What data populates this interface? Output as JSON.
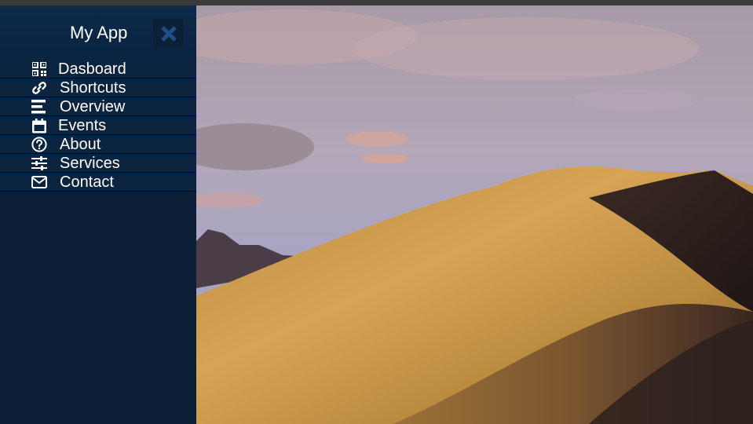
{
  "app": {
    "title": "My App"
  },
  "header": {
    "close_icon": "close-icon"
  },
  "menu": {
    "items": [
      {
        "label": "Dasboard",
        "icon": "qr-grid-icon"
      },
      {
        "label": "Shortcuts",
        "icon": "link-icon"
      },
      {
        "label": "Overview",
        "icon": "bars-icon"
      },
      {
        "label": "Events",
        "icon": "calendar-icon"
      },
      {
        "label": "About",
        "icon": "question-circle-icon"
      },
      {
        "label": "Services",
        "icon": "sliders-icon"
      },
      {
        "label": "Contact",
        "icon": "envelope-icon"
      }
    ]
  },
  "colors": {
    "sidebar_bg": "#0b1f37",
    "header_bg": "#0d2a4a",
    "close_icon": "#1f4f86",
    "text": "#ffffff"
  }
}
